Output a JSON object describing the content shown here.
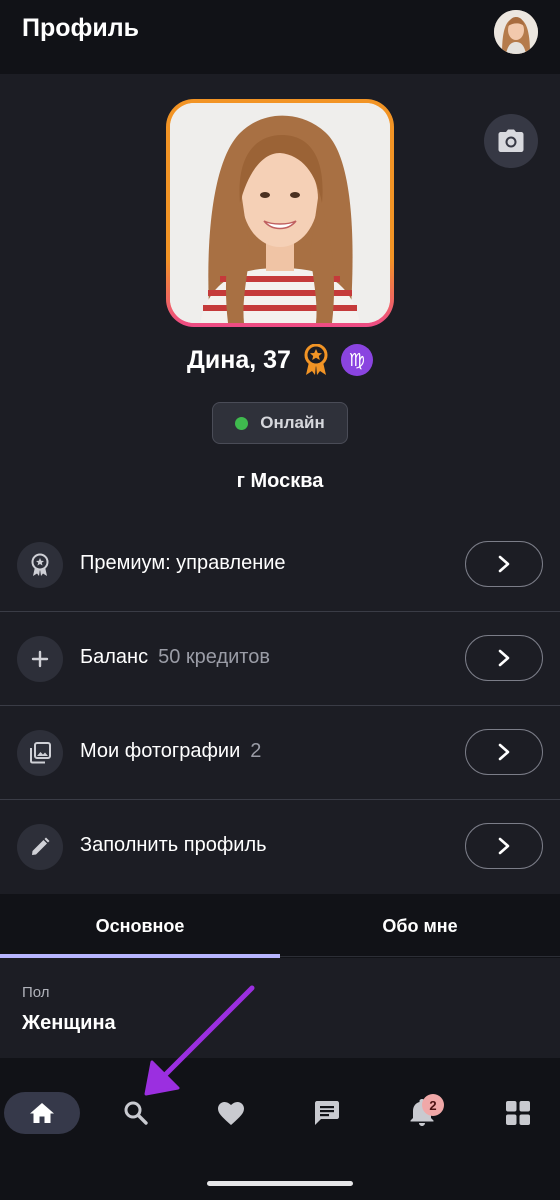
{
  "header": {
    "title": "Профиль",
    "avatar_icon": "user-avatar"
  },
  "profile": {
    "name_age": "Дина, 37",
    "premium_icon": "award-medal-icon",
    "zodiac_symbol": "♍",
    "status": "Онлайн",
    "status_color": "#3fba4e",
    "city": "г Москва",
    "photo_border_colors": [
      "#f29425",
      "#ee4a86"
    ]
  },
  "menu": {
    "items": [
      {
        "label": "Премиум: управление",
        "sub": "",
        "icon": "award-icon"
      },
      {
        "label": "Баланс",
        "sub": "50 кредитов",
        "icon": "plus-icon"
      },
      {
        "label": "Мои фотографии",
        "sub": "2",
        "icon": "photos-icon"
      },
      {
        "label": "Заполнить профиль",
        "sub": "",
        "icon": "pencil-icon"
      }
    ]
  },
  "tabs": [
    {
      "label": "Основное",
      "active": true
    },
    {
      "label": "Обо мне",
      "active": false
    }
  ],
  "field": {
    "label": "Пол",
    "value": "Женщина"
  },
  "bottom_nav": {
    "items": [
      "home",
      "search",
      "likes",
      "messages",
      "notifications",
      "apps"
    ],
    "active": "home",
    "notification_count": "2"
  },
  "colors": {
    "background": "#111217",
    "card": "#1c1d24",
    "accent_tab": "#b7b5ff",
    "annotation_arrow": "#9b2fe0"
  }
}
